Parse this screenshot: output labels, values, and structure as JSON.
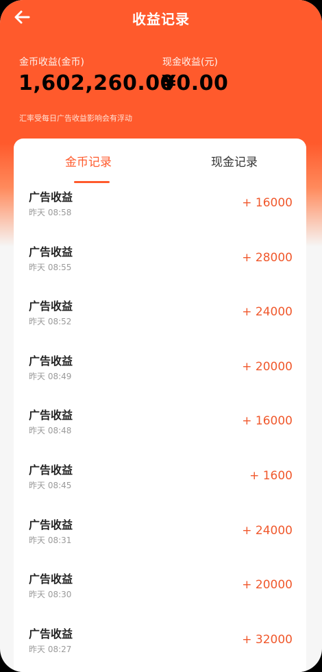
{
  "header": {
    "title": "收益记录"
  },
  "summary": {
    "coin_label": "金币收益(金币)",
    "coin_value": "1,602,260.00",
    "cash_label": "现金收益(元)",
    "cash_value": "¥0.00",
    "note": "汇率受每日广告收益影响会有浮动"
  },
  "tabs": [
    {
      "label": "金币记录",
      "active": true
    },
    {
      "label": "现金记录",
      "active": false
    }
  ],
  "records": [
    {
      "title": "广告收益",
      "time": "昨天 08:58",
      "amount": "+ 16000"
    },
    {
      "title": "广告收益",
      "time": "昨天 08:55",
      "amount": "+ 28000"
    },
    {
      "title": "广告收益",
      "time": "昨天 08:52",
      "amount": "+ 24000"
    },
    {
      "title": "广告收益",
      "time": "昨天 08:49",
      "amount": "+ 20000"
    },
    {
      "title": "广告收益",
      "time": "昨天 08:48",
      "amount": "+ 16000"
    },
    {
      "title": "广告收益",
      "time": "昨天 08:45",
      "amount": "+ 1600"
    },
    {
      "title": "广告收益",
      "time": "昨天 08:31",
      "amount": "+ 24000"
    },
    {
      "title": "广告收益",
      "time": "昨天 08:30",
      "amount": "+ 20000"
    },
    {
      "title": "广告收益",
      "time": "昨天 08:27",
      "amount": "+ 32000"
    }
  ],
  "colors": {
    "brand": "#ff5a2c",
    "amount": "#f0582c",
    "background": "#f6f6f6"
  },
  "icons": {
    "back": "arrow-left-icon"
  }
}
